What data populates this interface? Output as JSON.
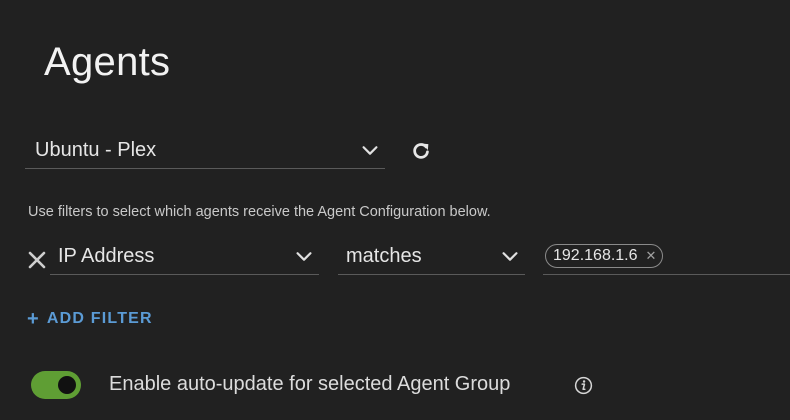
{
  "page": {
    "title": "Agents"
  },
  "agent_group": {
    "selected": "Ubuntu - Plex"
  },
  "filters": {
    "hint": "Use filters to select which agents receive the Agent Configuration below.",
    "rows": [
      {
        "field": "IP Address",
        "operator": "matches",
        "values": [
          "192.168.1.6"
        ]
      }
    ],
    "add_label": "ADD FILTER"
  },
  "auto_update": {
    "label": "Enable auto-update for selected Agent Group",
    "enabled": true
  },
  "colors": {
    "background": "#212121",
    "accent_link": "#5b9bd5",
    "toggle_on": "#5f9e34"
  },
  "icons": {
    "dropdown": "chevron-down-icon",
    "refresh": "refresh-icon",
    "remove_filter": "close-icon",
    "chip_remove": "close-icon",
    "add": "plus-icon",
    "info": "info-icon"
  }
}
